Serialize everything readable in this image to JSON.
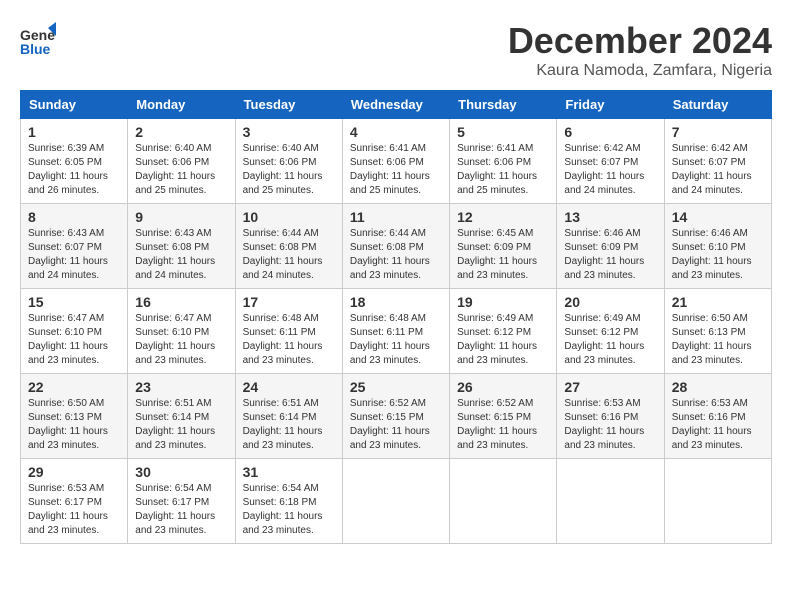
{
  "header": {
    "logo_line1": "General",
    "logo_line2": "Blue",
    "month": "December 2024",
    "location": "Kaura Namoda, Zamfara, Nigeria"
  },
  "days_of_week": [
    "Sunday",
    "Monday",
    "Tuesday",
    "Wednesday",
    "Thursday",
    "Friday",
    "Saturday"
  ],
  "weeks": [
    [
      {
        "day": "1",
        "info": "Sunrise: 6:39 AM\nSunset: 6:05 PM\nDaylight: 11 hours\nand 26 minutes."
      },
      {
        "day": "2",
        "info": "Sunrise: 6:40 AM\nSunset: 6:06 PM\nDaylight: 11 hours\nand 25 minutes."
      },
      {
        "day": "3",
        "info": "Sunrise: 6:40 AM\nSunset: 6:06 PM\nDaylight: 11 hours\nand 25 minutes."
      },
      {
        "day": "4",
        "info": "Sunrise: 6:41 AM\nSunset: 6:06 PM\nDaylight: 11 hours\nand 25 minutes."
      },
      {
        "day": "5",
        "info": "Sunrise: 6:41 AM\nSunset: 6:06 PM\nDaylight: 11 hours\nand 25 minutes."
      },
      {
        "day": "6",
        "info": "Sunrise: 6:42 AM\nSunset: 6:07 PM\nDaylight: 11 hours\nand 24 minutes."
      },
      {
        "day": "7",
        "info": "Sunrise: 6:42 AM\nSunset: 6:07 PM\nDaylight: 11 hours\nand 24 minutes."
      }
    ],
    [
      {
        "day": "8",
        "info": "Sunrise: 6:43 AM\nSunset: 6:07 PM\nDaylight: 11 hours\nand 24 minutes."
      },
      {
        "day": "9",
        "info": "Sunrise: 6:43 AM\nSunset: 6:08 PM\nDaylight: 11 hours\nand 24 minutes."
      },
      {
        "day": "10",
        "info": "Sunrise: 6:44 AM\nSunset: 6:08 PM\nDaylight: 11 hours\nand 24 minutes."
      },
      {
        "day": "11",
        "info": "Sunrise: 6:44 AM\nSunset: 6:08 PM\nDaylight: 11 hours\nand 23 minutes."
      },
      {
        "day": "12",
        "info": "Sunrise: 6:45 AM\nSunset: 6:09 PM\nDaylight: 11 hours\nand 23 minutes."
      },
      {
        "day": "13",
        "info": "Sunrise: 6:46 AM\nSunset: 6:09 PM\nDaylight: 11 hours\nand 23 minutes."
      },
      {
        "day": "14",
        "info": "Sunrise: 6:46 AM\nSunset: 6:10 PM\nDaylight: 11 hours\nand 23 minutes."
      }
    ],
    [
      {
        "day": "15",
        "info": "Sunrise: 6:47 AM\nSunset: 6:10 PM\nDaylight: 11 hours\nand 23 minutes."
      },
      {
        "day": "16",
        "info": "Sunrise: 6:47 AM\nSunset: 6:10 PM\nDaylight: 11 hours\nand 23 minutes."
      },
      {
        "day": "17",
        "info": "Sunrise: 6:48 AM\nSunset: 6:11 PM\nDaylight: 11 hours\nand 23 minutes."
      },
      {
        "day": "18",
        "info": "Sunrise: 6:48 AM\nSunset: 6:11 PM\nDaylight: 11 hours\nand 23 minutes."
      },
      {
        "day": "19",
        "info": "Sunrise: 6:49 AM\nSunset: 6:12 PM\nDaylight: 11 hours\nand 23 minutes."
      },
      {
        "day": "20",
        "info": "Sunrise: 6:49 AM\nSunset: 6:12 PM\nDaylight: 11 hours\nand 23 minutes."
      },
      {
        "day": "21",
        "info": "Sunrise: 6:50 AM\nSunset: 6:13 PM\nDaylight: 11 hours\nand 23 minutes."
      }
    ],
    [
      {
        "day": "22",
        "info": "Sunrise: 6:50 AM\nSunset: 6:13 PM\nDaylight: 11 hours\nand 23 minutes."
      },
      {
        "day": "23",
        "info": "Sunrise: 6:51 AM\nSunset: 6:14 PM\nDaylight: 11 hours\nand 23 minutes."
      },
      {
        "day": "24",
        "info": "Sunrise: 6:51 AM\nSunset: 6:14 PM\nDaylight: 11 hours\nand 23 minutes."
      },
      {
        "day": "25",
        "info": "Sunrise: 6:52 AM\nSunset: 6:15 PM\nDaylight: 11 hours\nand 23 minutes."
      },
      {
        "day": "26",
        "info": "Sunrise: 6:52 AM\nSunset: 6:15 PM\nDaylight: 11 hours\nand 23 minutes."
      },
      {
        "day": "27",
        "info": "Sunrise: 6:53 AM\nSunset: 6:16 PM\nDaylight: 11 hours\nand 23 minutes."
      },
      {
        "day": "28",
        "info": "Sunrise: 6:53 AM\nSunset: 6:16 PM\nDaylight: 11 hours\nand 23 minutes."
      }
    ],
    [
      {
        "day": "29",
        "info": "Sunrise: 6:53 AM\nSunset: 6:17 PM\nDaylight: 11 hours\nand 23 minutes."
      },
      {
        "day": "30",
        "info": "Sunrise: 6:54 AM\nSunset: 6:17 PM\nDaylight: 11 hours\nand 23 minutes."
      },
      {
        "day": "31",
        "info": "Sunrise: 6:54 AM\nSunset: 6:18 PM\nDaylight: 11 hours\nand 23 minutes."
      },
      {
        "day": "",
        "info": ""
      },
      {
        "day": "",
        "info": ""
      },
      {
        "day": "",
        "info": ""
      },
      {
        "day": "",
        "info": ""
      }
    ]
  ]
}
